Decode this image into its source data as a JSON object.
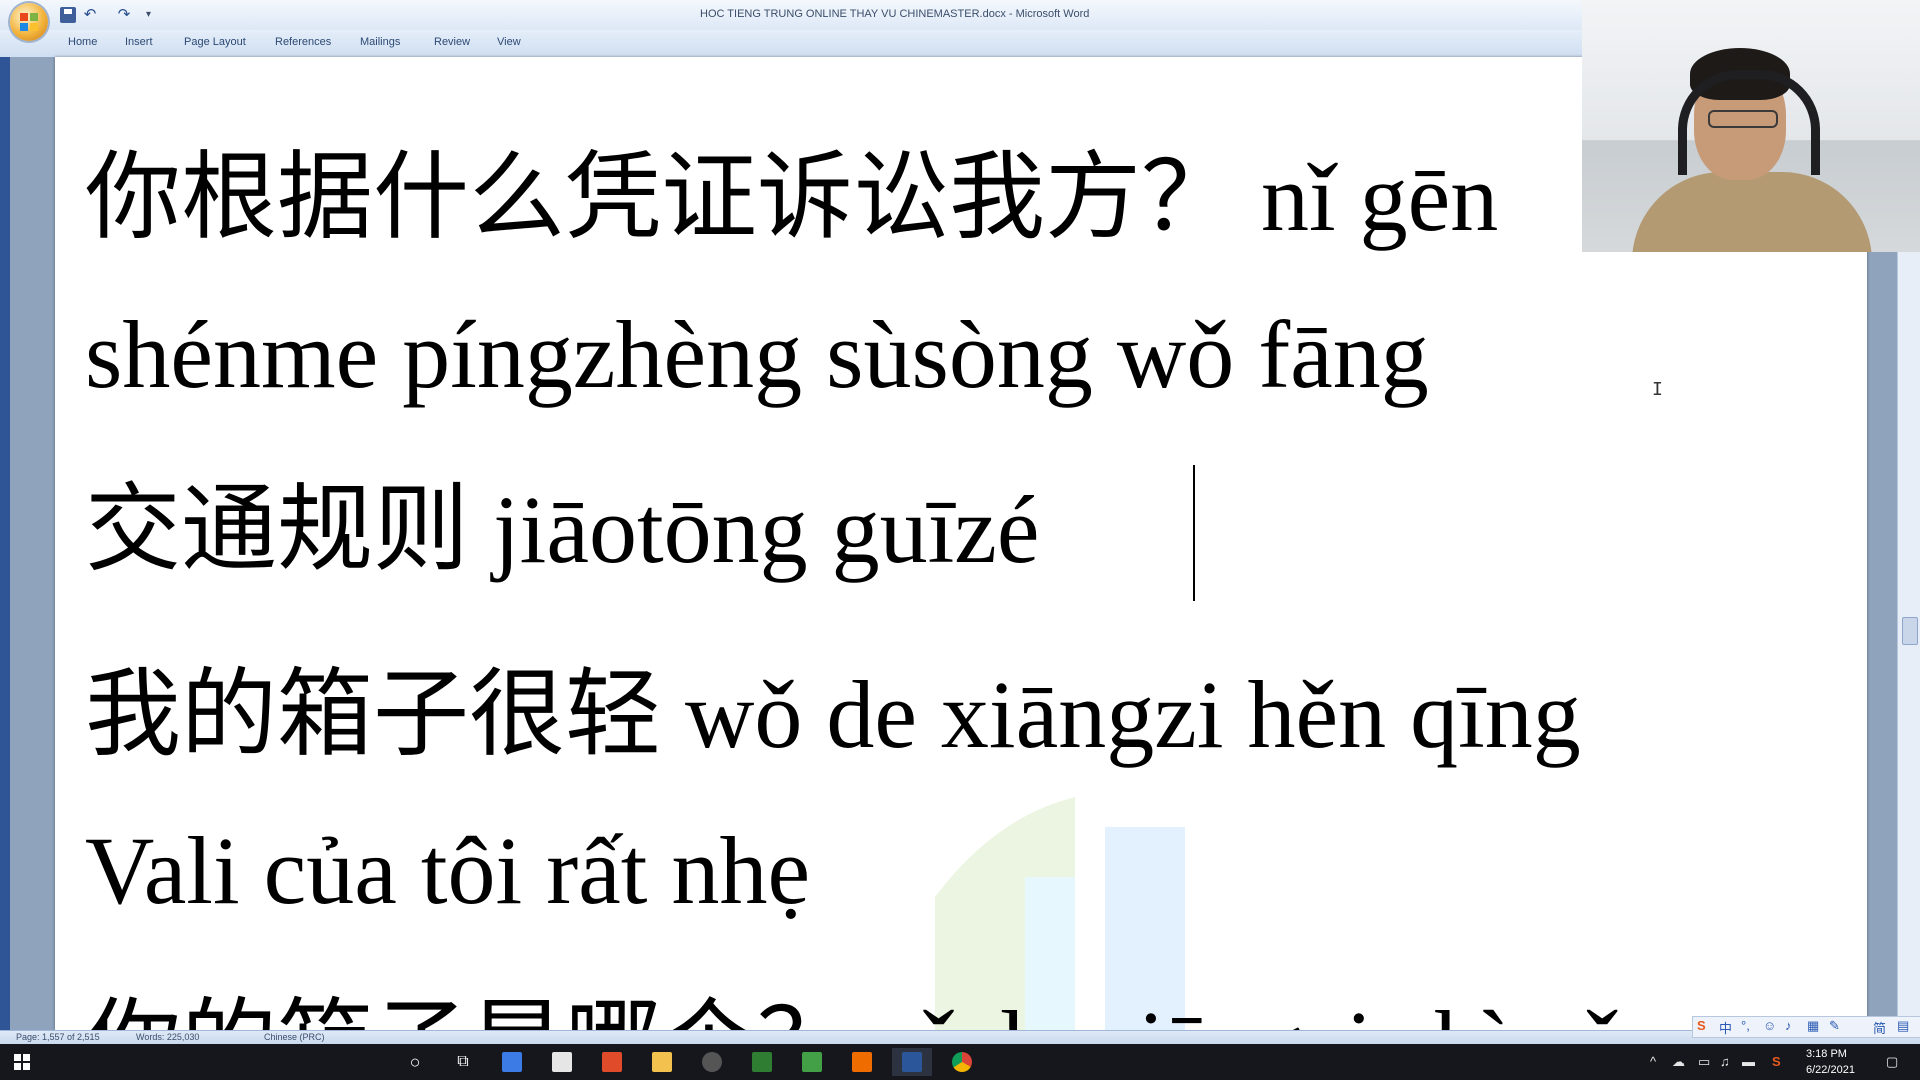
{
  "window": {
    "title": "HOC TIENG TRUNG ONLINE THAY VU CHINEMASTER.docx - Microsoft Word",
    "qat_undo": "↶",
    "qat_redo": "↷",
    "qat_more": "▾"
  },
  "ribbon": {
    "tabs": [
      "Home",
      "Insert",
      "Page Layout",
      "References",
      "Mailings",
      "Review",
      "View"
    ]
  },
  "document": {
    "lines": [
      "你根据什么凭证诉讼我方？ nǐ gēn",
      "shénme píngzhèng sùsòng wǒ fāng",
      "交通规则  jiāotōng guīzé",
      "我的箱子很轻 wǒ de xiāngzi hěn qīng",
      "Vali của tôi rất nhẹ",
      "你的箱子是哪个？ nǐ de xiāngzi shì nǎ"
    ],
    "ibeam": "I"
  },
  "statusbar": {
    "page": "Page: 1,557 of 2,515",
    "words": "Words: 225,030",
    "language": "Chinese (PRC)"
  },
  "ime": {
    "logo": "S",
    "mode": "中",
    "punct": "°,",
    "emoji": "☺",
    "mic": "♪",
    "keyboard": "▦",
    "skin": "✎",
    "simplified": "简",
    "grid": "▤"
  },
  "taskbar": {
    "search": "○",
    "taskview": "⧉",
    "time": "3:18 PM",
    "date": "6/22/2021",
    "tray_chevron": "^",
    "tray_notify": "▢"
  }
}
